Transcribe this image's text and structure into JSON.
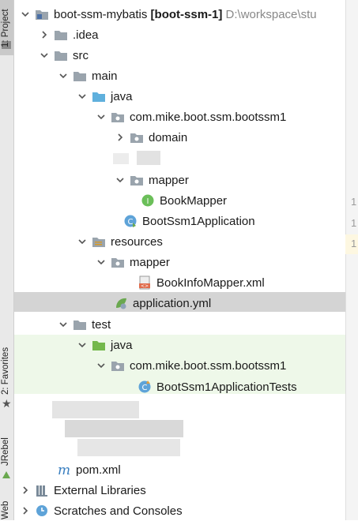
{
  "side_tabs": {
    "project": "1: Project",
    "favorites": "2: Favorites",
    "jrebel": "JRebel",
    "web": "Web"
  },
  "tree": {
    "root": {
      "name": "boot-ssm-mybatis",
      "module": "[boot-ssm-1]",
      "path": "D:\\workspace\\stu"
    },
    "idea": ".idea",
    "src": "src",
    "main": "main",
    "java_main": "java",
    "package_main": "com.mike.boot.ssm.bootssm1",
    "domain": "domain",
    "mapper_pkg": "mapper",
    "book_mapper": "BookMapper",
    "app_class": "BootSsm1Application",
    "resources": "resources",
    "mapper_res": "mapper",
    "mapper_xml": "BookInfoMapper.xml",
    "application_yml": "application.yml",
    "test": "test",
    "java_test": "java",
    "package_test": "com.mike.boot.ssm.bootssm1",
    "test_class": "BootSsm1ApplicationTests",
    "pom": "pom.xml",
    "external_libraries": "External Libraries",
    "scratches": "Scratches and Consoles"
  },
  "gutter_numbers": [
    "1",
    "1",
    "1"
  ],
  "colors": {
    "folder": "#9aa4ad",
    "source_root": "#5fb0dd",
    "test_root": "#74b84c",
    "selection": "#d4d4d4",
    "test_highlight": "#eef8e9"
  }
}
